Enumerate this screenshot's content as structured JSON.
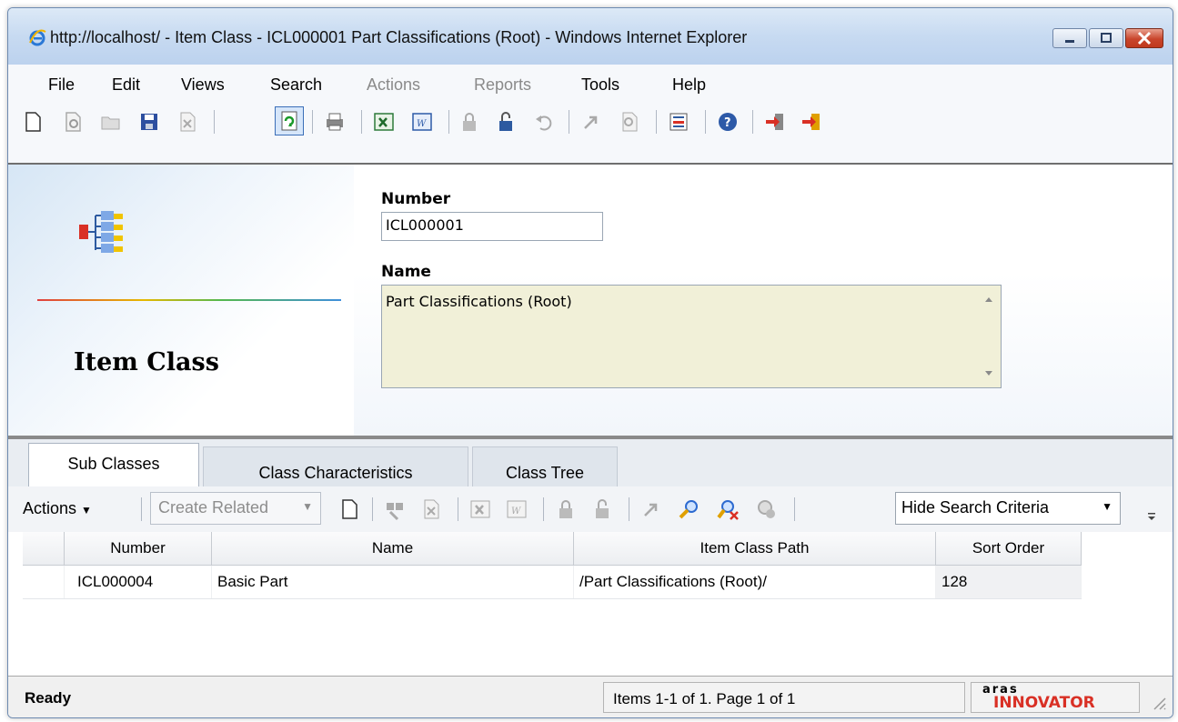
{
  "window": {
    "title": "http://localhost/ - Item Class - ICL000001 Part Classifications (Root) - Windows Internet Explorer"
  },
  "menu": {
    "items": [
      {
        "label": "File",
        "enabled": true
      },
      {
        "label": "Edit",
        "enabled": true
      },
      {
        "label": "Views",
        "enabled": true
      },
      {
        "label": "Search",
        "enabled": true
      },
      {
        "label": "Actions",
        "enabled": false
      },
      {
        "label": "Reports",
        "enabled": false
      },
      {
        "label": "Tools",
        "enabled": true
      },
      {
        "label": "Help",
        "enabled": true
      }
    ]
  },
  "toolbar": {
    "icons": [
      "new-document-icon",
      "view-icon",
      "open-folder-icon",
      "save-icon",
      "delete-icon",
      "refresh-icon",
      "print-icon",
      "excel-icon",
      "word-icon",
      "lock-icon",
      "unlock-icon",
      "undo-icon",
      "promote-icon",
      "where-used-icon",
      "report-icon",
      "help-icon",
      "login-icon",
      "exit-icon"
    ]
  },
  "form": {
    "item_type": "Item Class",
    "number_label": "Number",
    "number_value": "ICL000001",
    "name_label": "Name",
    "name_value": "Part Classifications (Root)"
  },
  "tabs": [
    {
      "label": "Sub Classes",
      "active": true
    },
    {
      "label": "Class Characteristics",
      "active": false
    },
    {
      "label": "Class Tree",
      "active": false
    }
  ],
  "grid_toolbar": {
    "actions_label": "Actions",
    "create_related_label": "Create Related",
    "hide_search_label": "Hide Search Criteria"
  },
  "grid": {
    "columns": [
      "Number",
      "Name",
      "Item Class Path",
      "Sort Order"
    ],
    "rows": [
      {
        "number": "ICL000004",
        "name": "Basic Part",
        "path": "/Part Classifications (Root)/",
        "sort_order": "128"
      }
    ]
  },
  "status": {
    "state": "Ready",
    "paging": "Items 1-1 of 1. Page 1 of 1",
    "brand_top": "aras",
    "brand_bottom": "INNOVATOR"
  },
  "colors": {
    "accent": "#3f8fdc",
    "name_field_bg": "#f1f0d8",
    "brand_red": "#d93025"
  }
}
